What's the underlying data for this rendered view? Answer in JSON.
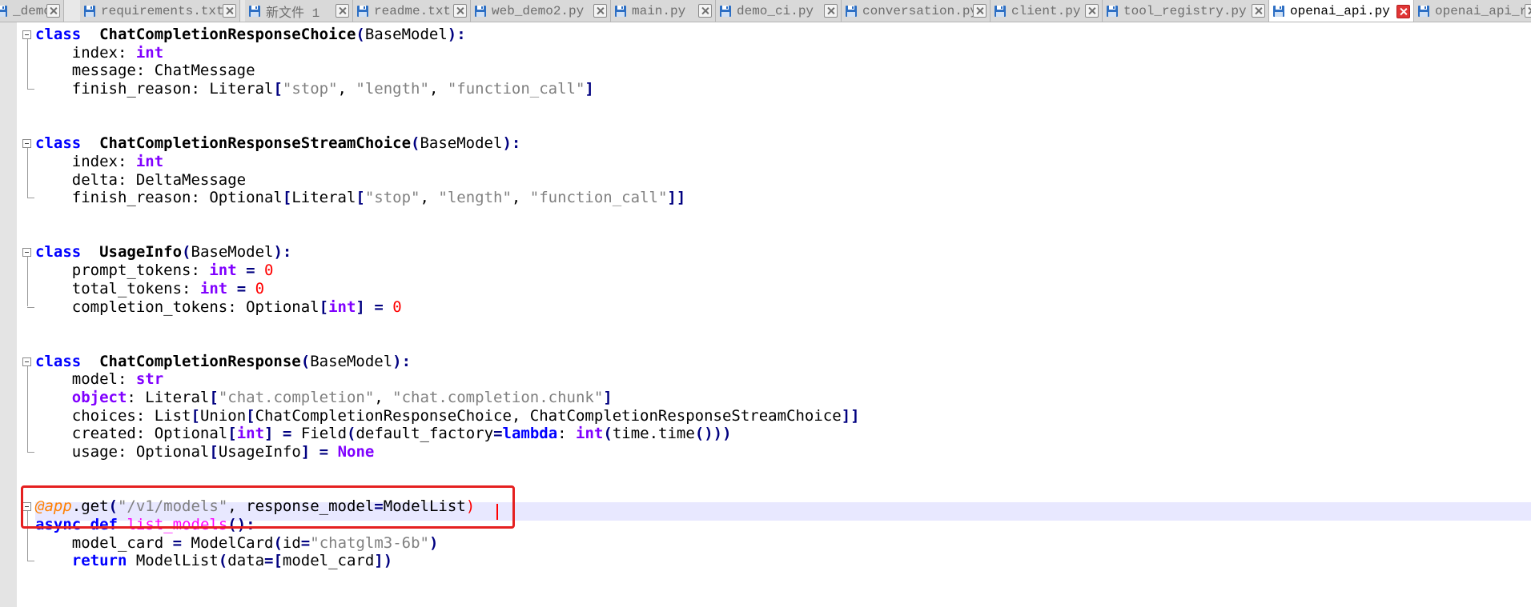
{
  "tabs": [
    {
      "label": "_demo.py",
      "active": false
    },
    {
      "label": "requirements.txt",
      "active": false
    },
    {
      "label": "新文件 1",
      "active": false
    },
    {
      "label": "readme.txt",
      "active": false
    },
    {
      "label": "web_demo2.py",
      "active": false
    },
    {
      "label": "main.py",
      "active": false
    },
    {
      "label": "demo_ci.py",
      "active": false
    },
    {
      "label": "conversation.py",
      "active": false
    },
    {
      "label": "client.py",
      "active": false
    },
    {
      "label": "tool_registry.py",
      "active": false
    },
    {
      "label": "openai_api.py",
      "active": true
    },
    {
      "label": "openai_api_re",
      "active": false
    }
  ],
  "icons": {
    "file": "save-disk-icon",
    "close": "close-icon",
    "active_close_color": "#e03535",
    "file_icon_color": "#2d6fc4"
  },
  "code": [
    {
      "indent": "",
      "tokens": [
        [
          "kw",
          "class"
        ],
        [
          "",
          "  "
        ],
        [
          "cn",
          "ChatCompletionResponseChoice"
        ],
        [
          "op",
          "("
        ],
        [
          "",
          "BaseModel"
        ],
        [
          "op",
          "):"
        ]
      ]
    },
    {
      "indent": "    ",
      "tokens": [
        [
          "",
          "index: "
        ],
        [
          "ty",
          "int"
        ]
      ]
    },
    {
      "indent": "    ",
      "tokens": [
        [
          "",
          "message: ChatMessage"
        ]
      ]
    },
    {
      "indent": "    ",
      "tokens": [
        [
          "",
          "finish_reason: Literal"
        ],
        [
          "op",
          "["
        ],
        [
          "st",
          "\"stop\""
        ],
        [
          "",
          ", "
        ],
        [
          "st",
          "\"length\""
        ],
        [
          "",
          ", "
        ],
        [
          "st",
          "\"function_call\""
        ],
        [
          "op",
          "]"
        ]
      ]
    },
    {
      "indent": "",
      "tokens": []
    },
    {
      "indent": "",
      "tokens": []
    },
    {
      "indent": "",
      "tokens": [
        [
          "kw",
          "class"
        ],
        [
          "",
          "  "
        ],
        [
          "cn",
          "ChatCompletionResponseStreamChoice"
        ],
        [
          "op",
          "("
        ],
        [
          "",
          "BaseModel"
        ],
        [
          "op",
          "):"
        ]
      ]
    },
    {
      "indent": "    ",
      "tokens": [
        [
          "",
          "index: "
        ],
        [
          "ty",
          "int"
        ]
      ]
    },
    {
      "indent": "    ",
      "tokens": [
        [
          "",
          "delta: DeltaMessage"
        ]
      ]
    },
    {
      "indent": "    ",
      "tokens": [
        [
          "",
          "finish_reason: Optional"
        ],
        [
          "op",
          "["
        ],
        [
          "",
          "Literal"
        ],
        [
          "op",
          "["
        ],
        [
          "st",
          "\"stop\""
        ],
        [
          "",
          ", "
        ],
        [
          "st",
          "\"length\""
        ],
        [
          "",
          ", "
        ],
        [
          "st",
          "\"function_call\""
        ],
        [
          "op",
          "]]"
        ]
      ]
    },
    {
      "indent": "",
      "tokens": []
    },
    {
      "indent": "",
      "tokens": []
    },
    {
      "indent": "",
      "tokens": [
        [
          "kw",
          "class"
        ],
        [
          "",
          "  "
        ],
        [
          "cn",
          "UsageInfo"
        ],
        [
          "op",
          "("
        ],
        [
          "",
          "BaseModel"
        ],
        [
          "op",
          "):"
        ]
      ]
    },
    {
      "indent": "    ",
      "tokens": [
        [
          "",
          "prompt_tokens: "
        ],
        [
          "ty",
          "int"
        ],
        [
          "",
          " "
        ],
        [
          "op",
          "="
        ],
        [
          "",
          " "
        ],
        [
          "nm",
          "0"
        ]
      ]
    },
    {
      "indent": "    ",
      "tokens": [
        [
          "",
          "total_tokens: "
        ],
        [
          "ty",
          "int"
        ],
        [
          "",
          " "
        ],
        [
          "op",
          "="
        ],
        [
          "",
          " "
        ],
        [
          "nm",
          "0"
        ]
      ]
    },
    {
      "indent": "    ",
      "tokens": [
        [
          "",
          "completion_tokens: Optional"
        ],
        [
          "op",
          "["
        ],
        [
          "ty",
          "int"
        ],
        [
          "op",
          "]"
        ],
        [
          "",
          " "
        ],
        [
          "op",
          "="
        ],
        [
          "",
          " "
        ],
        [
          "nm",
          "0"
        ]
      ]
    },
    {
      "indent": "",
      "tokens": []
    },
    {
      "indent": "",
      "tokens": []
    },
    {
      "indent": "",
      "tokens": [
        [
          "kw",
          "class"
        ],
        [
          "",
          "  "
        ],
        [
          "cn",
          "ChatCompletionResponse"
        ],
        [
          "op",
          "("
        ],
        [
          "",
          "BaseModel"
        ],
        [
          "op",
          "):"
        ]
      ]
    },
    {
      "indent": "    ",
      "tokens": [
        [
          "",
          "model: "
        ],
        [
          "ty",
          "str"
        ]
      ]
    },
    {
      "indent": "    ",
      "tokens": [
        [
          "ty",
          "object"
        ],
        [
          "",
          ": Literal"
        ],
        [
          "op",
          "["
        ],
        [
          "st",
          "\"chat.completion\""
        ],
        [
          "",
          ", "
        ],
        [
          "st",
          "\"chat.completion.chunk\""
        ],
        [
          "op",
          "]"
        ]
      ]
    },
    {
      "indent": "    ",
      "tokens": [
        [
          "",
          "choices: List"
        ],
        [
          "op",
          "["
        ],
        [
          "",
          "Union"
        ],
        [
          "op",
          "["
        ],
        [
          "",
          "ChatCompletionResponseChoice, ChatCompletionResponseStreamChoice"
        ],
        [
          "op",
          "]]"
        ]
      ]
    },
    {
      "indent": "    ",
      "tokens": [
        [
          "",
          "created: Optional"
        ],
        [
          "op",
          "["
        ],
        [
          "ty",
          "int"
        ],
        [
          "op",
          "]"
        ],
        [
          "",
          " "
        ],
        [
          "op",
          "="
        ],
        [
          "",
          " Field"
        ],
        [
          "op",
          "("
        ],
        [
          "",
          "default_factory"
        ],
        [
          "op",
          "="
        ],
        [
          "kw",
          "lambda"
        ],
        [
          "",
          ": "
        ],
        [
          "ty",
          "int"
        ],
        [
          "op",
          "("
        ],
        [
          "",
          "time.time"
        ],
        [
          "op",
          "()))"
        ]
      ]
    },
    {
      "indent": "    ",
      "tokens": [
        [
          "",
          "usage: Optional"
        ],
        [
          "op",
          "["
        ],
        [
          "",
          "UsageInfo"
        ],
        [
          "op",
          "]"
        ],
        [
          "",
          " "
        ],
        [
          "op",
          "="
        ],
        [
          "",
          " "
        ],
        [
          "ty",
          "None"
        ]
      ]
    },
    {
      "indent": "",
      "tokens": []
    },
    {
      "indent": "",
      "tokens": []
    },
    {
      "indent": "",
      "tokens": [
        [
          "dc",
          "@app"
        ],
        [
          "",
          ".get"
        ],
        [
          "op",
          "("
        ],
        [
          "st",
          "\"/v1/models\""
        ],
        [
          "",
          ", response_model"
        ],
        [
          "op",
          "="
        ],
        [
          "",
          "ModelList"
        ],
        [
          "nm",
          ")"
        ]
      ]
    },
    {
      "indent": "",
      "tokens": [
        [
          "kw",
          "async"
        ],
        [
          "",
          " "
        ],
        [
          "kw",
          "def"
        ],
        [
          "",
          " "
        ],
        [
          "fn",
          "list_models"
        ],
        [
          "op",
          "():"
        ]
      ]
    },
    {
      "indent": "    ",
      "tokens": [
        [
          "",
          "model_card "
        ],
        [
          "op",
          "="
        ],
        [
          "",
          " ModelCard"
        ],
        [
          "op",
          "("
        ],
        [
          "",
          "id"
        ],
        [
          "op",
          "="
        ],
        [
          "st",
          "\"chatglm3-6b\""
        ],
        [
          "op",
          ")"
        ]
      ]
    },
    {
      "indent": "    ",
      "tokens": [
        [
          "kw",
          "return"
        ],
        [
          "",
          " ModelList"
        ],
        [
          "op",
          "("
        ],
        [
          "",
          "data"
        ],
        [
          "op",
          "=["
        ],
        [
          "",
          "model_card"
        ],
        [
          "op",
          "])"
        ]
      ]
    }
  ]
}
